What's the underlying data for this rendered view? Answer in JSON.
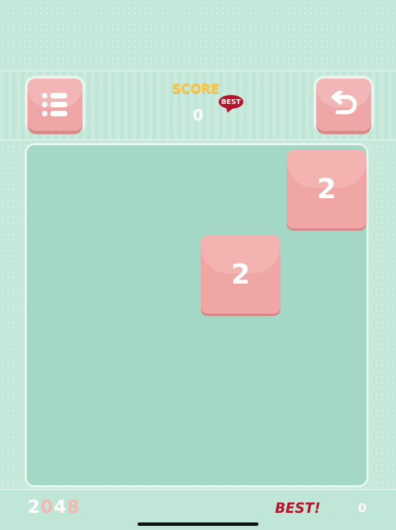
{
  "header": {
    "menu_icon": "list-menu-icon",
    "undo_icon": "undo-arrow-icon",
    "score_label": "SCORE",
    "best_badge": "BEST",
    "score_value": "0"
  },
  "board": {
    "tiles": [
      {
        "value": "2",
        "row": 0,
        "col": 3
      },
      {
        "value": "2",
        "row": 1,
        "col": 2
      }
    ]
  },
  "footer": {
    "logo_digits": [
      "2",
      "0",
      "4",
      "8"
    ],
    "best_label": "BEST!",
    "best_value": "0"
  },
  "colors": {
    "background": "#c6e8da",
    "board": "#a2d8c5",
    "tile": "#f0a6a4",
    "score_label": "#f6c84a",
    "best_red": "#b3162b"
  }
}
